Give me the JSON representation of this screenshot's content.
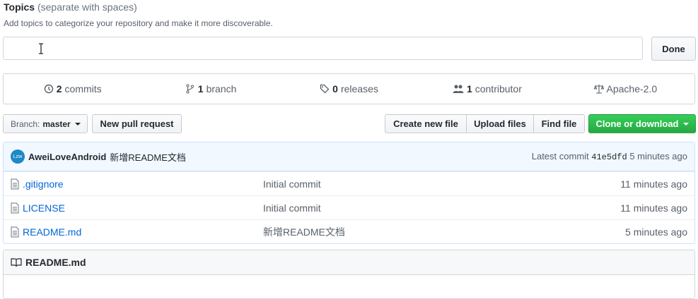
{
  "topics": {
    "title": "Topics",
    "hint": "(separate with spaces)",
    "description": "Add topics to categorize your repository and make it more discoverable.",
    "input_value": "",
    "done_label": "Done"
  },
  "summary": {
    "commits_count": "2",
    "commits_label": "commits",
    "branch_count": "1",
    "branch_label": "branch",
    "releases_count": "0",
    "releases_label": "releases",
    "contributor_count": "1",
    "contributor_label": "contributor",
    "license": "Apache-2.0"
  },
  "toolbar": {
    "branch_prefix": "Branch:",
    "branch_name": "master",
    "new_pr_label": "New pull request",
    "create_file_label": "Create new file",
    "upload_files_label": "Upload files",
    "find_file_label": "Find file",
    "clone_label": "Clone or download",
    "clone_color": "#28a745"
  },
  "latest_commit": {
    "avatar_text": "Lzw",
    "author": "AweiLoveAndroid",
    "message": "新增README文档",
    "prefix": "Latest commit",
    "sha": "41e5dfd",
    "age": "5 minutes ago"
  },
  "files": [
    {
      "name": ".gitignore",
      "message": "Initial commit",
      "age": "11 minutes ago"
    },
    {
      "name": "LICENSE",
      "message": "Initial commit",
      "age": "11 minutes ago"
    },
    {
      "name": "README.md",
      "message": "新增README文档",
      "age": "5 minutes ago"
    }
  ],
  "readme": {
    "title": "README.md"
  }
}
